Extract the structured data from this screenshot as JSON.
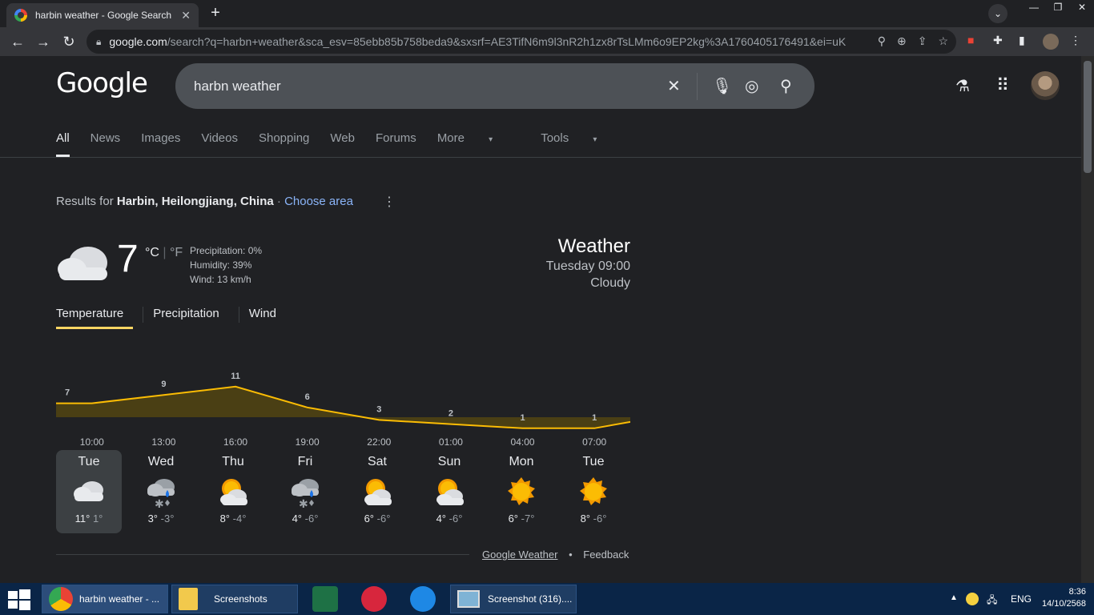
{
  "browser": {
    "tab_title": "harbin weather - Google Search",
    "url_host": "google.com",
    "url_rest": "/search?q=harbn+weather&sca_esv=85ebb85b758beda9&sxsrf=AE3TifN6m9l3nR2h1zx8rTsLMm6o9EP2kg%3A1760405176491&ei=uK..."
  },
  "google": {
    "logo": "Google",
    "query": "harbn weather",
    "nav": [
      "All",
      "News",
      "Images",
      "Videos",
      "Shopping",
      "Web",
      "Forums",
      "More",
      "Tools"
    ],
    "results_prefix": "Results for",
    "location": "Harbin, Heilongjiang, China",
    "choose_area": "Choose area"
  },
  "weather": {
    "temp": "7",
    "unit_c": "°C",
    "unit_f": "°F",
    "precip": "Precipitation: 0%",
    "humidity": "Humidity: 39%",
    "wind": "Wind: 13 km/h",
    "title": "Weather",
    "datetime": "Tuesday 09:00",
    "condition": "Cloudy",
    "tabs": [
      "Temperature",
      "Precipitation",
      "Wind"
    ],
    "days": [
      {
        "name": "Tue",
        "icon": "cloudy",
        "hi": "11°",
        "lo": "1°"
      },
      {
        "name": "Wed",
        "icon": "snow-rain",
        "hi": "3°",
        "lo": "-3°"
      },
      {
        "name": "Thu",
        "icon": "partly-cloudy",
        "hi": "8°",
        "lo": "-4°"
      },
      {
        "name": "Fri",
        "icon": "snow-rain",
        "hi": "4°",
        "lo": "-6°"
      },
      {
        "name": "Sat",
        "icon": "partly-cloudy",
        "hi": "6°",
        "lo": "-6°"
      },
      {
        "name": "Sun",
        "icon": "partly-cloudy",
        "hi": "4°",
        "lo": "-6°"
      },
      {
        "name": "Mon",
        "icon": "sunny",
        "hi": "6°",
        "lo": "-7°"
      },
      {
        "name": "Tue",
        "icon": "sunny",
        "hi": "8°",
        "lo": "-6°"
      }
    ],
    "footer_link": "Google Weather",
    "feedback": "Feedback"
  },
  "chart_data": {
    "type": "area",
    "x": [
      "10:00",
      "13:00",
      "16:00",
      "19:00",
      "22:00",
      "01:00",
      "04:00",
      "07:00"
    ],
    "series": [
      {
        "values": [
          7,
          9,
          11,
          6,
          3,
          2,
          1,
          1
        ]
      }
    ],
    "colors": {
      "line": "#fbbc04",
      "fill": "#4a3f14"
    }
  },
  "taskbar": {
    "items": [
      "harbin weather - ...",
      "Screenshots",
      "Screenshot (316)...."
    ],
    "lang": "ENG",
    "time": "8:36",
    "date": "14/10/2568"
  }
}
